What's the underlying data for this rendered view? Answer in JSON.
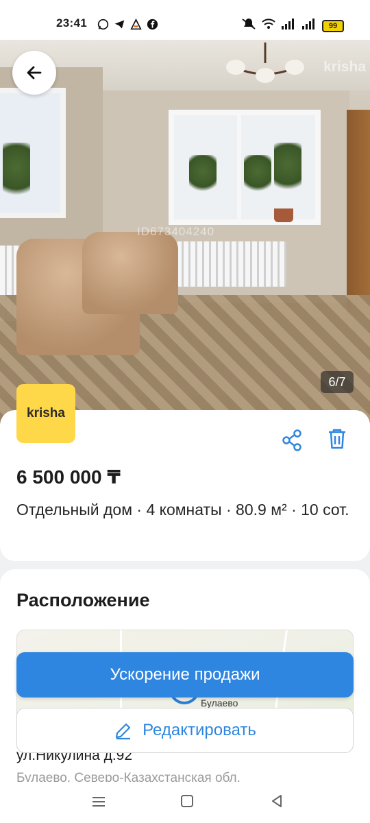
{
  "status_bar": {
    "time": "23:41",
    "battery": "99",
    "app_icons": [
      "whatsapp-icon",
      "telegram-icon",
      "alert-app-icon",
      "facebook-icon"
    ],
    "right_icons": [
      "mute-icon",
      "wifi-icon",
      "signal-icon",
      "signal-icon",
      "battery-icon"
    ]
  },
  "photo": {
    "watermark": "krisha",
    "id_watermark": "ID673404240",
    "counter": "6/7"
  },
  "listing": {
    "logo_text": "krisha",
    "price": "6 500 000 ₸",
    "description": "Отдельный дом · 4 комнаты · 80.9 м² · 10 сот."
  },
  "location": {
    "title": "Расположение",
    "map_label": "Булаево",
    "address": "ул.Никулина д.92",
    "region": "Булаево, Северо-Казахстанская обл."
  },
  "actions": {
    "boost_label": "Ускорение продажи",
    "edit_label": "Редактировать"
  },
  "colors": {
    "accent": "#2f86e0",
    "logo_bg": "#ffd84a"
  }
}
